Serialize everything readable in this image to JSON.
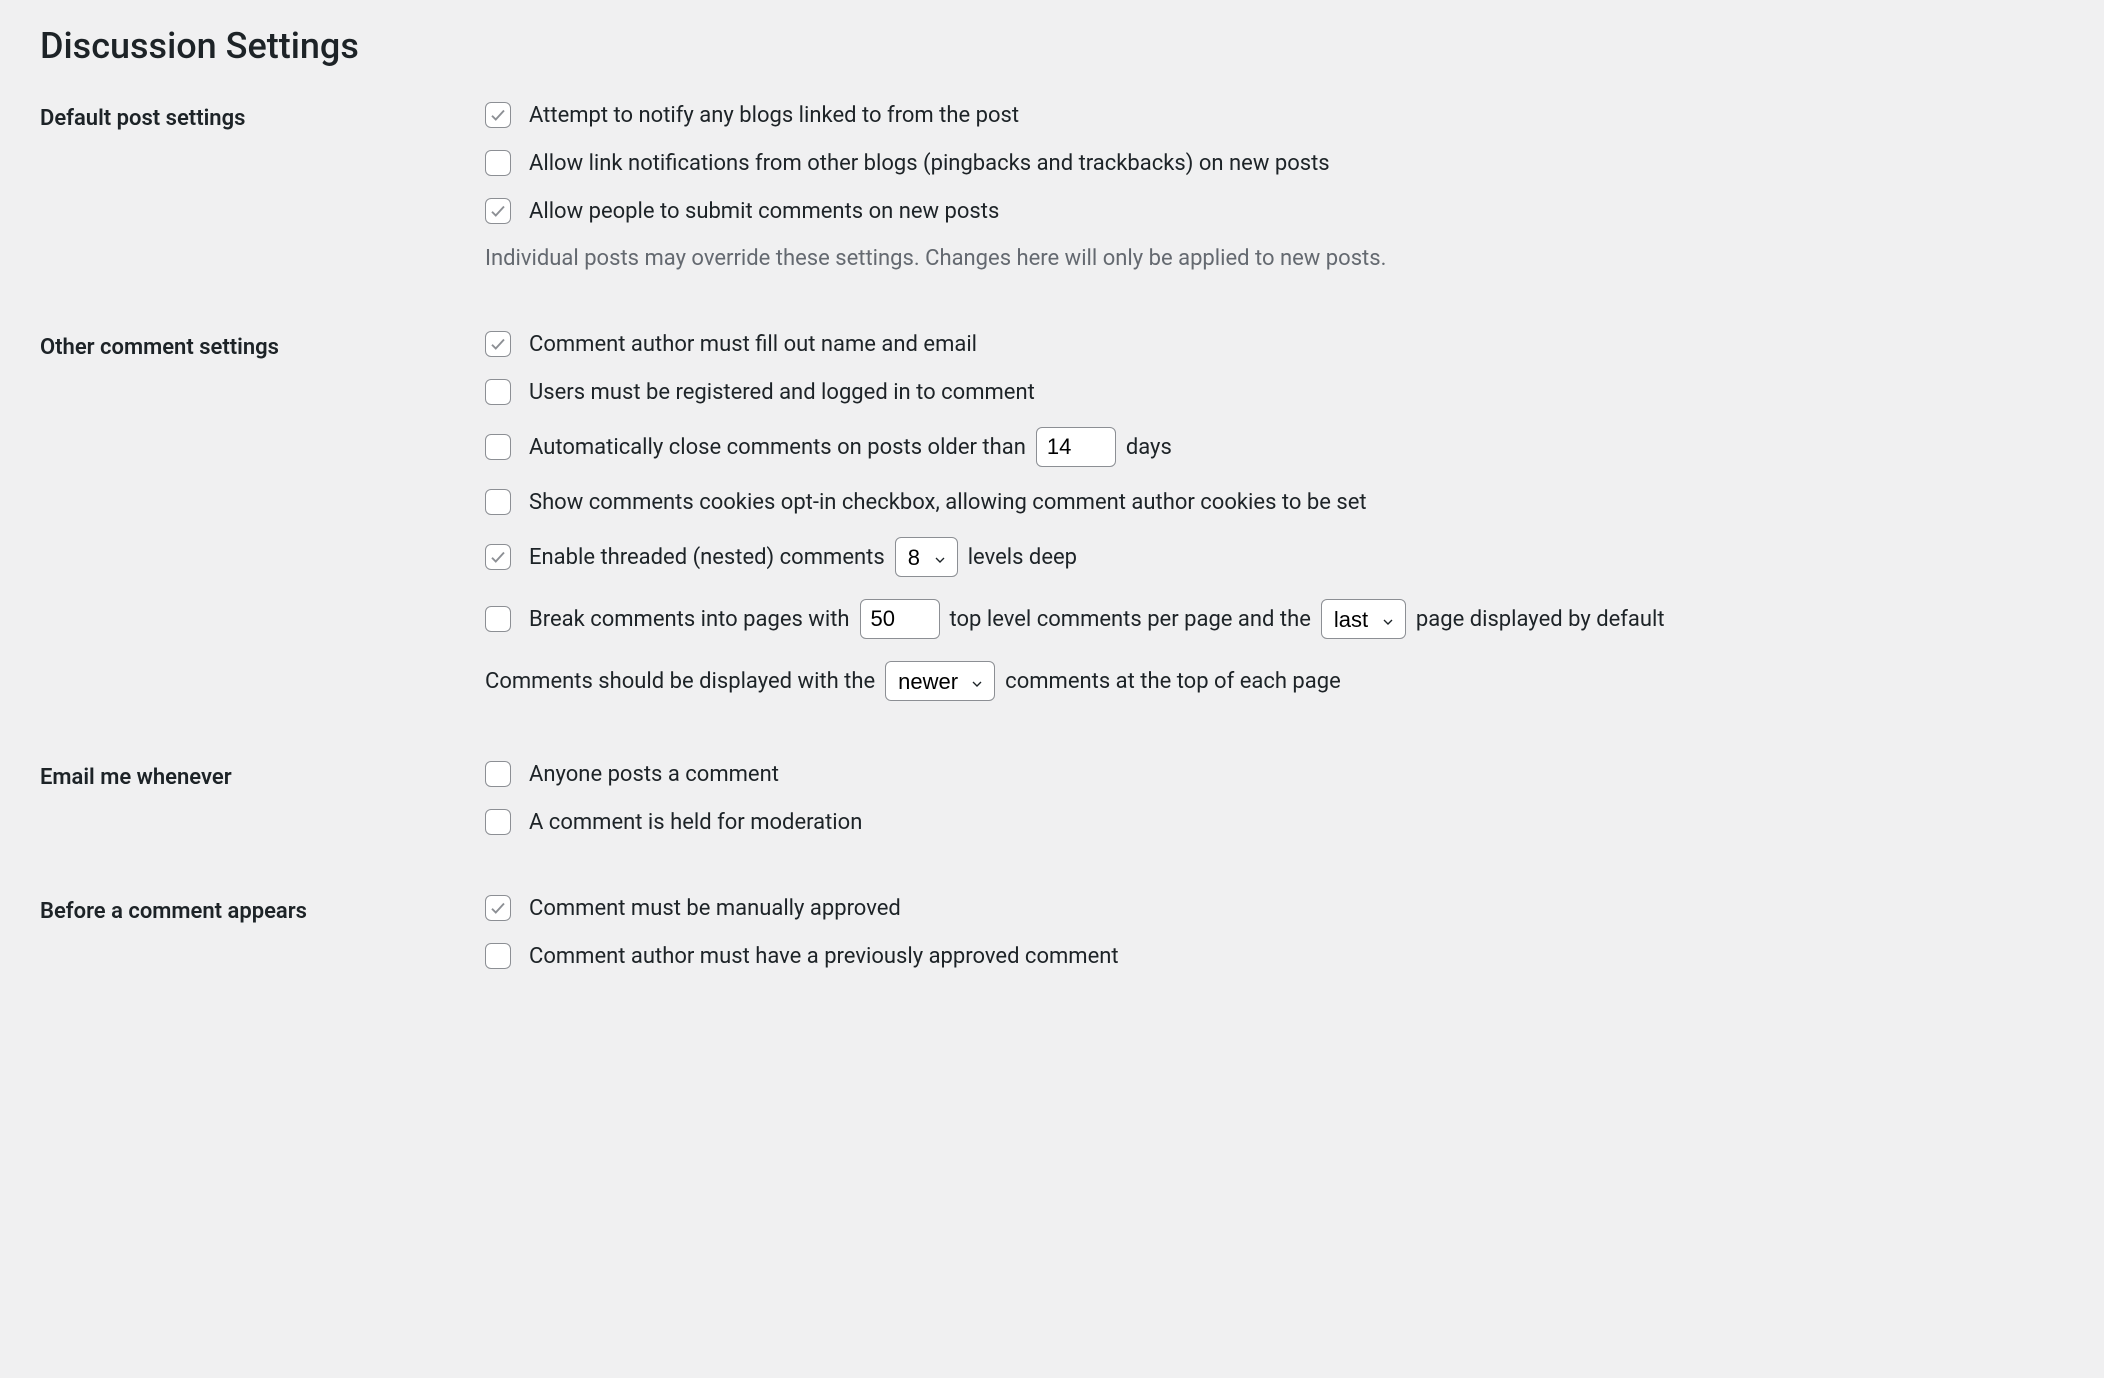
{
  "page_title": "Discussion Settings",
  "sections": {
    "default_post": {
      "label": "Default post settings",
      "notify_blogs": {
        "label": "Attempt to notify any blogs linked to from the post",
        "checked": true
      },
      "allow_pingbacks": {
        "label": "Allow link notifications from other blogs (pingbacks and trackbacks) on new posts",
        "checked": false
      },
      "allow_comments": {
        "label": "Allow people to submit comments on new posts",
        "checked": true
      },
      "description": "Individual posts may override these settings. Changes here will only be applied to new posts."
    },
    "other_comment": {
      "label": "Other comment settings",
      "name_email": {
        "label": "Comment author must fill out name and email",
        "checked": true
      },
      "registered": {
        "label": "Users must be registered and logged in to comment",
        "checked": false
      },
      "auto_close": {
        "label_before": "Automatically close comments on posts older than",
        "label_after": "days",
        "value": "14",
        "checked": false
      },
      "cookies_opt_in": {
        "label": "Show comments cookies opt-in checkbox, allowing comment author cookies to be set",
        "checked": false
      },
      "threaded": {
        "label_before": "Enable threaded (nested) comments",
        "label_after": "levels deep",
        "value": "8",
        "checked": true
      },
      "pagination": {
        "label_before": "Break comments into pages with",
        "label_mid": "top level comments per page and the",
        "label_after": "page displayed by default",
        "value": "50",
        "page_order": "last",
        "checked": false
      },
      "comment_order": {
        "label_before": "Comments should be displayed with the",
        "label_after": "comments at the top of each page",
        "value": "newer"
      }
    },
    "email_me": {
      "label": "Email me whenever",
      "anyone_posts": {
        "label": "Anyone posts a comment",
        "checked": false
      },
      "held_moderation": {
        "label": "A comment is held for moderation",
        "checked": false
      }
    },
    "before_appears": {
      "label": "Before a comment appears",
      "manual_approve": {
        "label": "Comment must be manually approved",
        "checked": true
      },
      "prev_approved": {
        "label": "Comment author must have a previously approved comment",
        "checked": false
      }
    }
  }
}
